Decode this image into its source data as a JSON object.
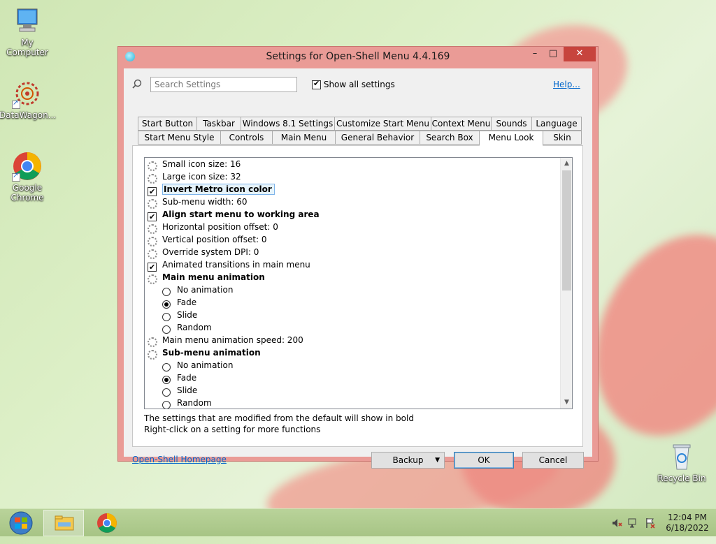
{
  "desktop": {
    "icons": [
      {
        "label": "My Computer"
      },
      {
        "label": "DataWagon..."
      },
      {
        "label": "Google Chrome"
      },
      {
        "label": "Recycle Bin"
      }
    ]
  },
  "window": {
    "title": "Settings for Open-Shell Menu 4.4.169",
    "search_placeholder": "Search Settings",
    "show_all_label": "Show all settings",
    "show_all_checked": true,
    "help_label": "Help...",
    "tabs_row1": [
      "Start Button",
      "Taskbar",
      "Windows 8.1 Settings",
      "Customize Start Menu",
      "Context Menu",
      "Sounds",
      "Language"
    ],
    "tabs_row2": [
      "Start Menu Style",
      "Controls",
      "Main Menu",
      "General Behavior",
      "Search Box",
      "Menu Look",
      "Skin"
    ],
    "active_tab": "Menu Look",
    "settings": [
      {
        "kind": "gear",
        "label": "Small icon size: 16",
        "bold": false
      },
      {
        "kind": "gear",
        "label": "Large icon size: 32",
        "bold": false
      },
      {
        "kind": "check",
        "label": "Invert Metro icon color",
        "bold": true,
        "checked": true,
        "selected": true
      },
      {
        "kind": "gear",
        "label": "Sub-menu width: 60",
        "bold": false
      },
      {
        "kind": "check",
        "label": "Align start menu to working area",
        "bold": true,
        "checked": true
      },
      {
        "kind": "gear",
        "label": "Horizontal position offset: 0",
        "bold": false
      },
      {
        "kind": "gear",
        "label": "Vertical position offset: 0",
        "bold": false
      },
      {
        "kind": "gear",
        "label": "Override system DPI: 0",
        "bold": false
      },
      {
        "kind": "check",
        "label": "Animated transitions in main menu",
        "bold": false,
        "checked": true
      },
      {
        "kind": "gear",
        "label": "Main menu animation",
        "bold": true
      },
      {
        "kind": "radio",
        "label": "No animation",
        "checked": false
      },
      {
        "kind": "radio",
        "label": "Fade",
        "checked": true
      },
      {
        "kind": "radio",
        "label": "Slide",
        "checked": false
      },
      {
        "kind": "radio",
        "label": "Random",
        "checked": false
      },
      {
        "kind": "gear",
        "label": "Main menu animation speed: 200",
        "bold": false
      },
      {
        "kind": "gear",
        "label": "Sub-menu animation",
        "bold": true
      },
      {
        "kind": "radio",
        "label": "No animation",
        "checked": false
      },
      {
        "kind": "radio",
        "label": "Fade",
        "checked": true
      },
      {
        "kind": "radio",
        "label": "Slide",
        "checked": false
      },
      {
        "kind": "radio",
        "label": "Random",
        "checked": false
      }
    ],
    "note_line1": "The settings that are modified from the default will show in bold",
    "note_line2": "Right-click on a setting for more functions",
    "homepage_link": "Open-Shell Homepage",
    "backup_label": "Backup",
    "ok_label": "OK",
    "cancel_label": "Cancel"
  },
  "taskbar": {
    "clock_time": "12:04 PM",
    "clock_date": "6/18/2022"
  },
  "colors": {
    "window_frame": "#ea9b96",
    "close_button": "#c7443d",
    "link": "#0066cc",
    "taskbar": "#b9d39a"
  }
}
